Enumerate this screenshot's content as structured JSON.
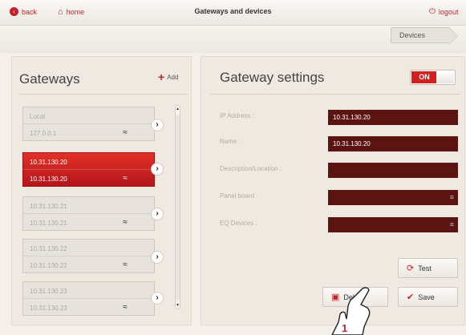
{
  "topbar": {
    "back_label": "back",
    "home_label": "home",
    "title": "Gateways and devices",
    "logout_label": "logout"
  },
  "breadcrumb": {
    "current": "Devices"
  },
  "gateways": {
    "heading": "Gateways",
    "add_label": "Add",
    "items": [
      {
        "name": "Local",
        "address": "127.0.0.1",
        "selected": false
      },
      {
        "name": "10.31.130.20",
        "address": "10.31.130.20",
        "selected": true
      },
      {
        "name": "10.31.130.21",
        "address": "10.31.130.21",
        "selected": false
      },
      {
        "name": "10.31.130.22",
        "address": "10.31.130.22",
        "selected": false
      },
      {
        "name": "10.31.130.23",
        "address": "10.31.130.23",
        "selected": false
      }
    ]
  },
  "settings": {
    "heading": "Gateway settings",
    "toggle_label": "ON",
    "fields": [
      {
        "label": "IP Address :",
        "value": "10.31.130.20"
      },
      {
        "label": "Name :",
        "value": "10.31.130.20"
      },
      {
        "label": "Description/Location :",
        "value": ""
      },
      {
        "label": "Panel board :",
        "value": ""
      },
      {
        "label": "EQ Devices :",
        "value": ""
      }
    ],
    "test_label": "Test",
    "delete_label": "Delete",
    "save_label": "Save"
  },
  "annotation": {
    "step": "1"
  },
  "colors": {
    "accent": "#c0242a",
    "field_bg": "#5a1412",
    "selected_bg": "#d8211f"
  }
}
